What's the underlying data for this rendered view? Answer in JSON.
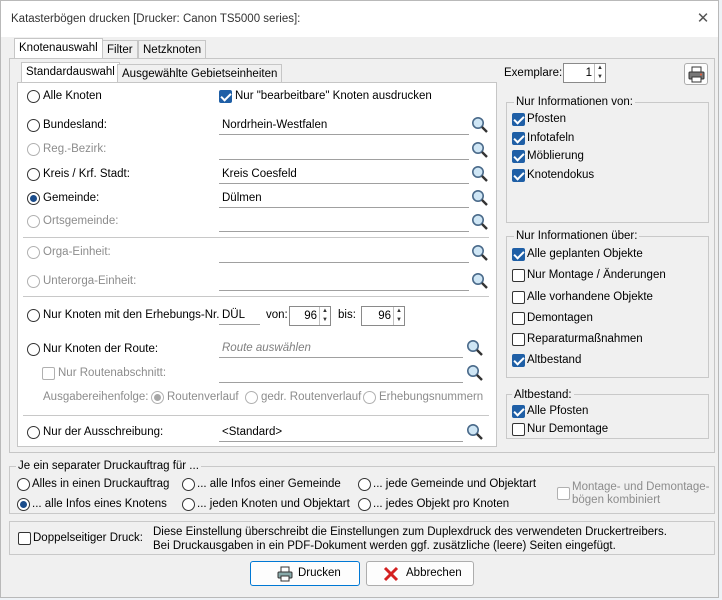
{
  "window": {
    "title": "Katasterbögen drucken [Drucker: Canon TS5000 series]:",
    "close_glyph": "✕"
  },
  "tabs": [
    "Knotenauswahl",
    "Filter",
    "Netzknoten"
  ],
  "subtabs": [
    "Standardauswahl",
    "Ausgewählte Gebietseinheiten"
  ],
  "selection": {
    "alle_knoten": "Alle Knoten",
    "nur_bearbeitbar": "Nur \"bearbeitbare\" Knoten ausdrucken",
    "bundesland": {
      "label": "Bundesland:",
      "value": "Nordrhein-Westfalen"
    },
    "regbezirk": {
      "label": "Reg.-Bezirk:",
      "value": ""
    },
    "kreis": {
      "label": "Kreis / Krf. Stadt:",
      "value": "Kreis Coesfeld"
    },
    "gemeinde": {
      "label": "Gemeinde:",
      "value": "Dülmen"
    },
    "ortsgemeinde": {
      "label": "Ortsgemeinde:",
      "value": ""
    },
    "orga": {
      "label": "Orga-Einheit:",
      "value": ""
    },
    "unterorga": {
      "label": "Unterorga-Einheit:",
      "value": ""
    },
    "erhebung": {
      "label": "Nur Knoten mit den Erhebungs-Nr.",
      "prefix": "DÜL",
      "von_label": "von:",
      "von": "96",
      "bis_label": "bis:",
      "bis": "96"
    },
    "route": {
      "label": "Nur Knoten der Route:",
      "placeholder": "Route auswählen"
    },
    "routenabschnitt": {
      "label": "Nur Routenabschnitt:",
      "value": ""
    },
    "ausgabe": {
      "label": "Ausgabereihenfolge:",
      "options": [
        "Routenverlauf",
        "gedr. Routenverlauf",
        "Erhebungsnummern"
      ]
    },
    "ausschreibung": {
      "label": "Nur der Ausschreibung:",
      "value": "<Standard>"
    }
  },
  "exemplare": {
    "label": "Exemplare:",
    "value": "1"
  },
  "info_von": {
    "title": "Nur Informationen von:",
    "items": [
      "Pfosten",
      "Infotafeln",
      "Möblierung",
      "Knotendokus"
    ]
  },
  "info_ueber": {
    "title": "Nur Informationen über:",
    "items": [
      "Alle geplanten Objekte",
      "Nur Montage / Änderungen",
      "Alle vorhandene Objekte",
      "Demontagen",
      "Reparaturmaßnahmen",
      "Altbestand"
    ]
  },
  "altbestand": {
    "title": "Altbestand:",
    "items": [
      "Alle Pfosten",
      "Nur Demontage"
    ]
  },
  "druckauftrag": {
    "title": "Je ein separater Druckauftrag für ...",
    "options": [
      "Alles in einen Druckauftrag",
      "... alle Infos einer Gemeinde",
      "... jede Gemeinde und Objektart",
      "... alle Infos eines Knotens",
      "... jeden Knoten und Objektart",
      "... jedes Objekt pro Knoten"
    ],
    "kombiniert": "Montage- und Demontage-\nbögen kombiniert"
  },
  "duplex": {
    "label": "Doppelseitiger Druck:",
    "note1": "Diese Einstellung überschreibt die Einstellungen zum Duplexdruck des verwendeten Druckertreibers.",
    "note2": "Bei Druckausgaben in ein PDF-Dokument werden ggf. zusätzliche (leere) Seiten eingefügt."
  },
  "buttons": {
    "print": "Drucken",
    "cancel": "Abbrechen"
  }
}
